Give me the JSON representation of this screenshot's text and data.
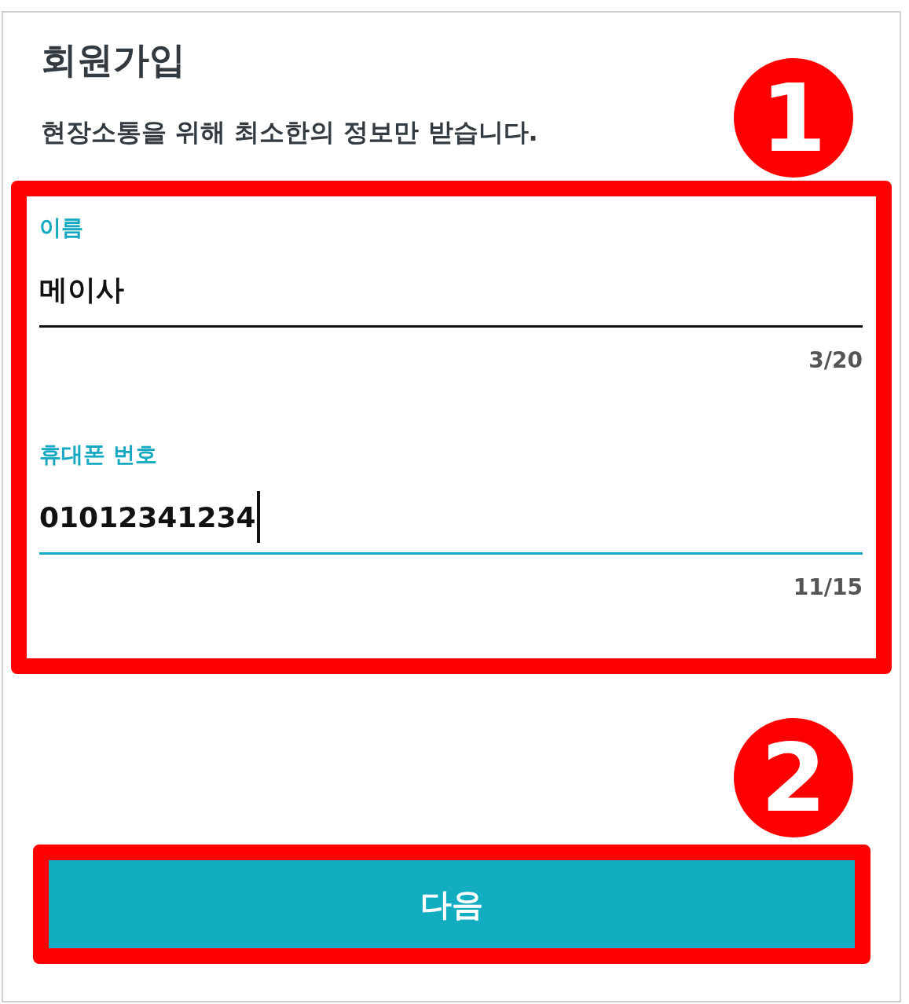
{
  "title": "회원가입",
  "subtitle": "현장소통을 위해 최소한의 정보만 받습니다.",
  "fields": [
    {
      "label": "이름",
      "value": "메이사",
      "counter": "3/20",
      "focused": false
    },
    {
      "label": "휴대폰 번호",
      "value": "01012341234",
      "counter": "11/15",
      "focused": true
    }
  ],
  "button": {
    "label": "다음"
  },
  "annotations": [
    {
      "label": "1"
    },
    {
      "label": "2"
    }
  ]
}
